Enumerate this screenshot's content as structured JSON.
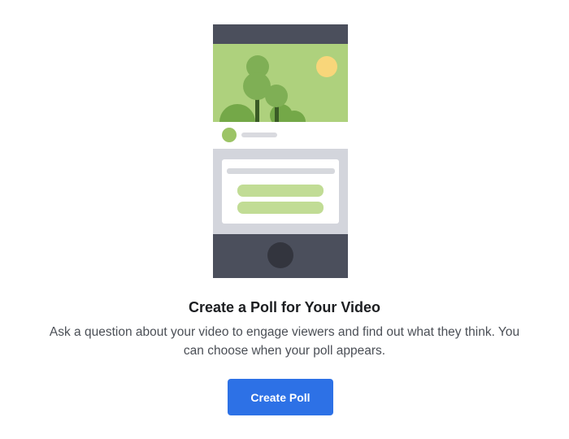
{
  "poll_intro": {
    "title": "Create a Poll for Your Video",
    "description": "Ask a question about your video to engage viewers and find out what they think. You can choose when your poll appears.",
    "create_button_label": "Create Poll"
  },
  "colors": {
    "accent": "#2d71e6",
    "title_text": "#1c1e21",
    "body_text": "#4b4f56",
    "phone_frame": "#4b4f5c",
    "scene_sky": "#aed17d",
    "poll_option": "#c1dc95"
  },
  "illustration": {
    "icons": [
      "phone-icon",
      "tree-icon",
      "sun-icon",
      "avatar-icon",
      "home-button-icon"
    ]
  }
}
